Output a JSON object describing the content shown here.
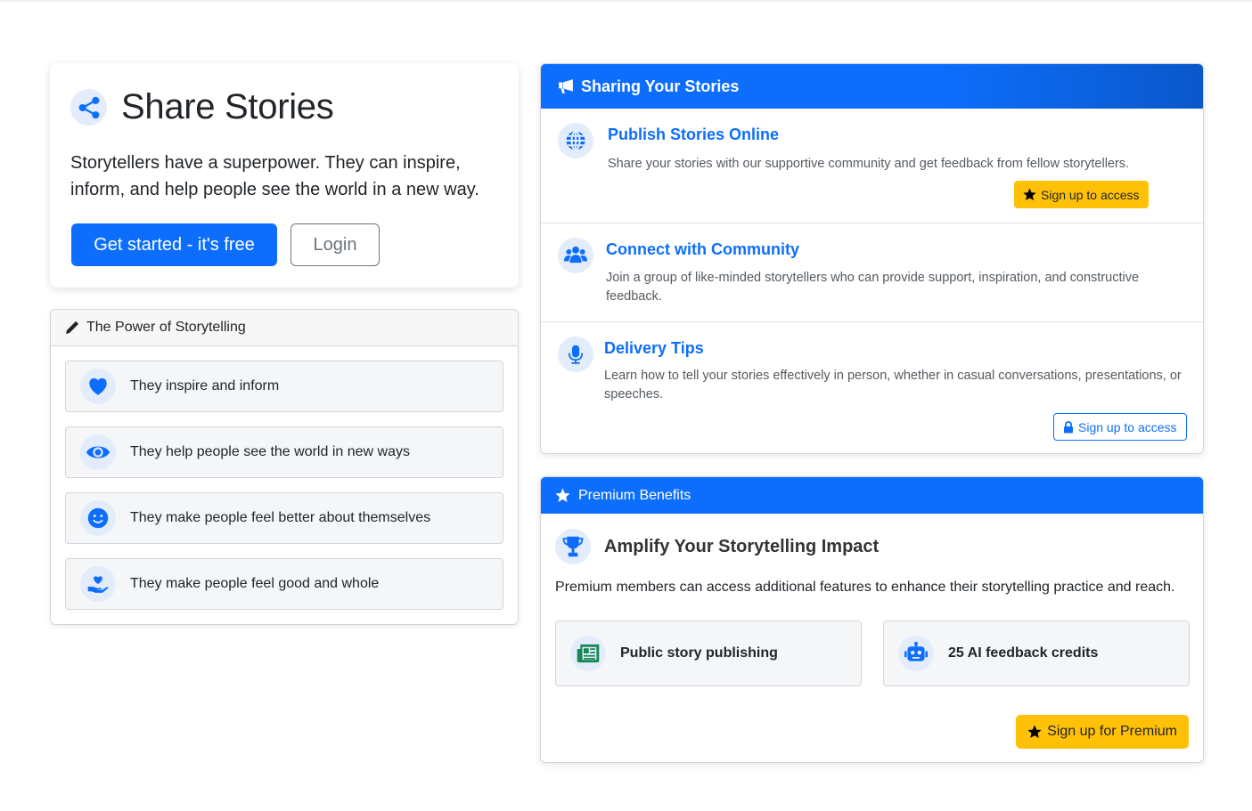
{
  "colors": {
    "primary": "#0d6efd",
    "warning": "#ffc107",
    "icon_bg": "#e3ecfb",
    "success_icon": "#198754"
  },
  "hero": {
    "icon": "share-icon",
    "title": "Share Stories",
    "description": "Storytellers have a superpower. They can inspire, inform, and help people see the world in a new way.",
    "primary_button": "Get started - it's free",
    "secondary_button": "Login"
  },
  "power": {
    "header_icon": "pencil-icon",
    "header": "The Power of Storytelling",
    "items": [
      {
        "icon": "heart-icon",
        "label": "They inspire and inform"
      },
      {
        "icon": "eye-icon",
        "label": "They help people see the world in new ways"
      },
      {
        "icon": "smile-icon",
        "label": "They make people feel better about themselves"
      },
      {
        "icon": "hand-heart-icon",
        "label": "They make people feel good and whole"
      }
    ]
  },
  "sharing": {
    "header_icon": "megaphone-icon",
    "header": "Sharing Your Stories",
    "features": [
      {
        "icon": "globe-icon",
        "title": "Publish Stories Online",
        "description": "Share your stories with our supportive community and get feedback from fellow storytellers.",
        "button": "Sign up to access"
      },
      {
        "icon": "people-icon",
        "title": "Connect with Community",
        "description": "Join a group of like-minded storytellers who can provide support, inspiration, and constructive feedback."
      },
      {
        "icon": "microphone-icon",
        "title": "Delivery Tips",
        "description": "Learn how to tell your stories effectively in person, whether in casual conversations, presentations, or speeches.",
        "button": "Sign up to access"
      }
    ]
  },
  "premium": {
    "header_icon": "star-icon",
    "header": "Premium Benefits",
    "title_icon": "trophy-icon",
    "title": "Amplify Your Storytelling Impact",
    "description": "Premium members can access additional features to enhance their storytelling practice and reach.",
    "benefits": [
      {
        "icon": "newspaper-icon",
        "label": "Public story publishing"
      },
      {
        "icon": "robot-icon",
        "label": "25 AI feedback credits"
      }
    ],
    "button": "Sign up for Premium"
  }
}
